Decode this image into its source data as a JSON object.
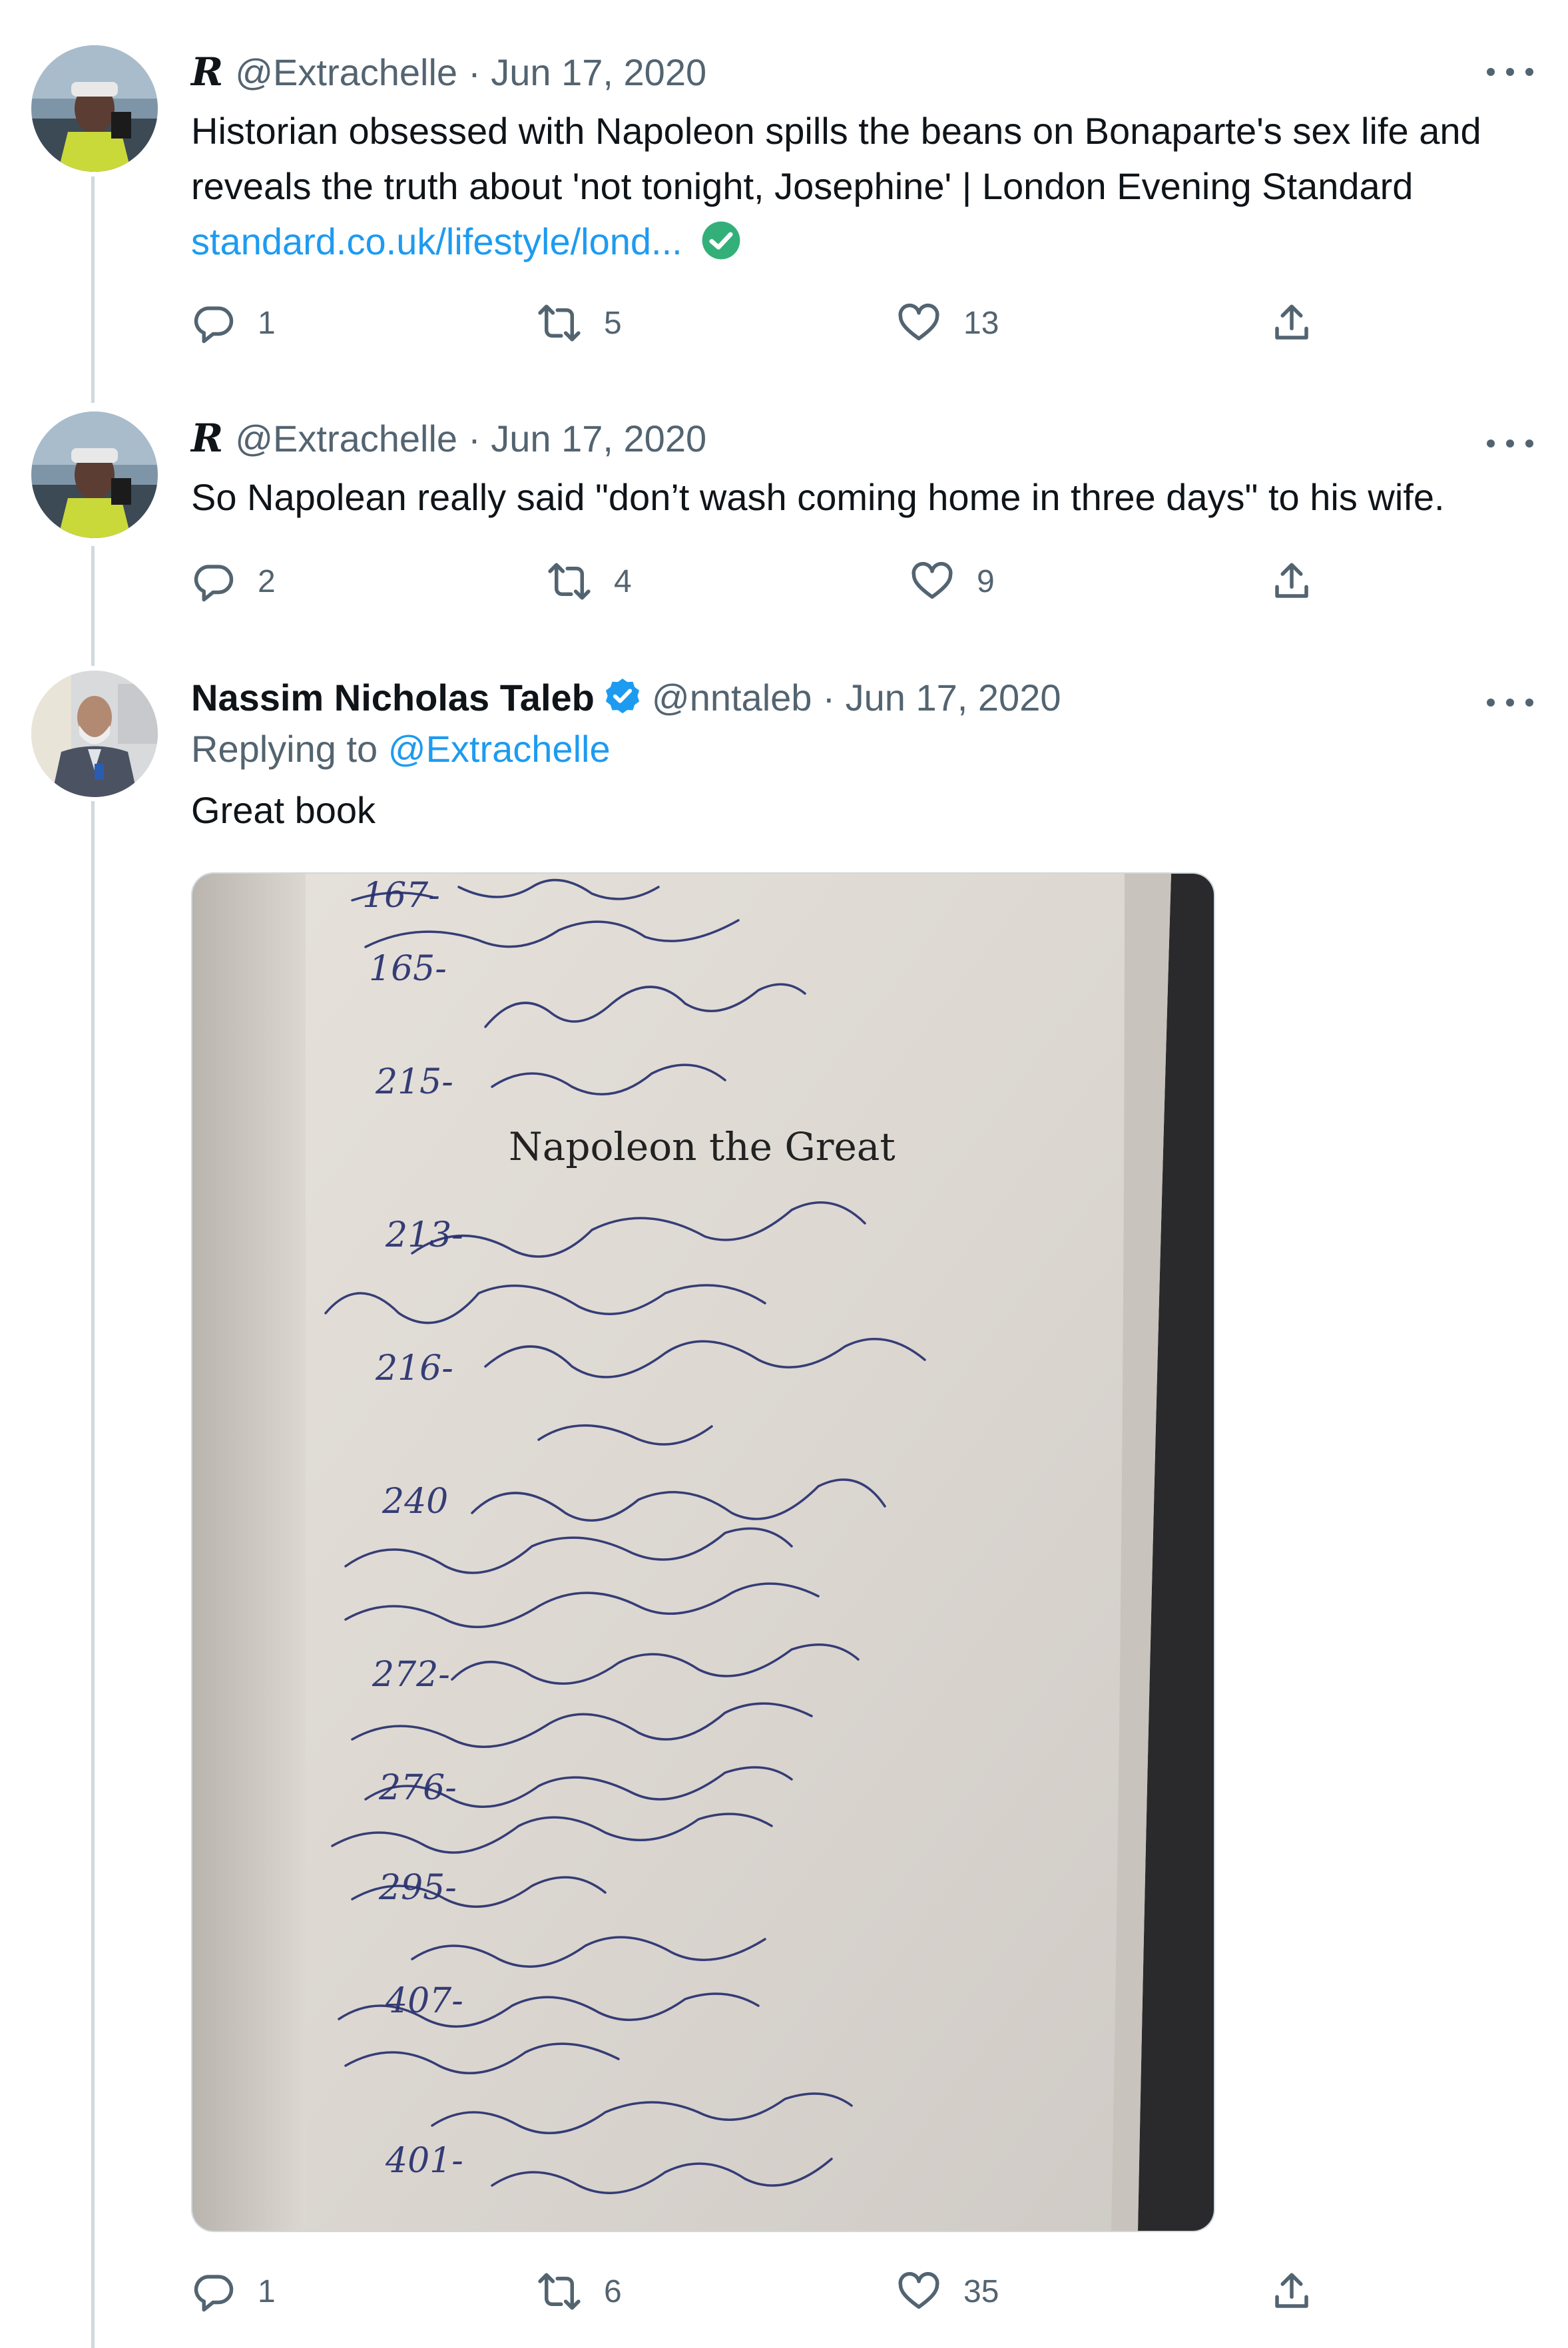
{
  "tweets": [
    {
      "handle": "@Extrachelle",
      "date": "· Jun 17, 2020",
      "text": "Historian obsessed with Napoleon spills the beans on Bonaparte's sex life and reveals the truth about 'not tonight, Josephine' | London Evening Standard ",
      "link": "standard.co.uk/lifestyle/lond...",
      "replies": "1",
      "retweets": "5",
      "likes": "13"
    },
    {
      "handle": "@Extrachelle",
      "date": "· Jun 17, 2020",
      "text": "So Napolean really said \"don’t wash coming home in three days\" to his wife.",
      "replies": "2",
      "retweets": "4",
      "likes": "9"
    },
    {
      "name": "Nassim Nicholas Taleb",
      "handle": "@nntaleb",
      "date": "· Jun 17, 2020",
      "replying_prefix": "Replying to ",
      "replying_handle": "@Extrachelle",
      "text": "Great book",
      "photo": {
        "book_title": "Napoleon the Great",
        "handwritten_notes": [
          "167-",
          "165-",
          "215-",
          "213-",
          "216-",
          "240",
          "272-",
          "276-",
          "295-",
          "407-",
          "401-"
        ]
      },
      "replies": "1",
      "retweets": "6",
      "likes": "35"
    }
  ],
  "colors": {
    "text": "#0f1419",
    "secondary": "#536471",
    "link": "#1d9bf0",
    "verified": "#1d9bf0",
    "divider": "#cfd9de"
  },
  "icons": [
    "more-icon",
    "reply-icon",
    "retweet-icon",
    "like-icon",
    "share-icon",
    "verified-badge-icon",
    "link-verified-icon"
  ]
}
